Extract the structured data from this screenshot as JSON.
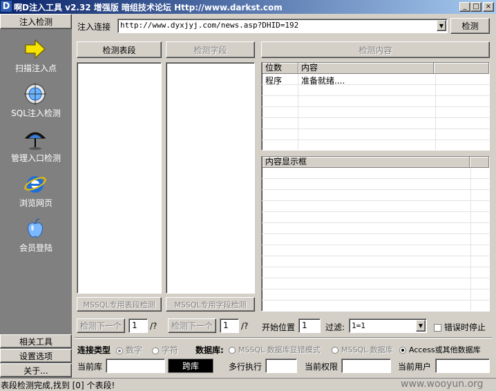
{
  "titlebar": {
    "icon_letter": "D",
    "title": "啊D注入工具 v2.32 增强版 暗组技术论坛 Http://www.darkst.com",
    "minimize": "_",
    "maximize": "□",
    "close": "×"
  },
  "sidebar": {
    "top_button": "注入检测",
    "items": [
      {
        "label": "扫描注入点",
        "icon": "arrow-icon"
      },
      {
        "label": "SQL注入检测",
        "icon": "globe-crosshair-icon"
      },
      {
        "label": "管理入口检测",
        "icon": "umbrella-icon"
      },
      {
        "label": "浏览网页",
        "icon": "ie-icon"
      },
      {
        "label": "会员登陆",
        "icon": "apple-icon"
      }
    ],
    "bottom_buttons": [
      "相关工具",
      "设置选项",
      "关于..."
    ]
  },
  "url_bar": {
    "label": "注入连接",
    "value": "http://www.dyxjyj.com/news.asp?DHID=192",
    "detect_button": "检测"
  },
  "panels": {
    "table_button": "检测表段",
    "field_button": "检测字段",
    "content_button": "检测内容",
    "mssql_table_button": "MSSQL专用表段检测",
    "mssql_field_button": "MSSQL专用字段检测"
  },
  "result_list": {
    "columns": [
      "位数",
      "内容"
    ],
    "rows": [
      [
        "程序",
        "准备就绪...."
      ]
    ]
  },
  "content_box": {
    "header": "内容显示框"
  },
  "paging": {
    "next_table": "检测下一个",
    "table_page": "1",
    "table_total": "/?",
    "next_field": "检测下一个",
    "field_page": "1",
    "field_total": "/?",
    "start_label": "开始位置",
    "start_value": "1",
    "filter_label": "过滤:",
    "filter_value": "1=1",
    "stop_on_error": "错误时停止"
  },
  "connection": {
    "type_label": "连接类型",
    "type_number": "数字",
    "type_string": "字符",
    "db_label": "数据库:",
    "db_mssql_error": "MSSQL 数据库显错模式",
    "db_mssql": "MSSQL 数据库",
    "db_access": "Access或其他数据库"
  },
  "info": {
    "current_db_label": "当前库",
    "cross_db_button": "跨库",
    "multi_exec_label": "多行执行",
    "permission_label": "当前权限",
    "user_label": "当前用户"
  },
  "statusbar": {
    "text": "表段检测完成,找到 [0] 个表段!",
    "watermark": "www.wooyun.org"
  },
  "colors": {
    "titlebar_start": "#0a246a",
    "titlebar_end": "#a6caf0",
    "face": "#d4d0c8",
    "sidebar": "#808080"
  }
}
